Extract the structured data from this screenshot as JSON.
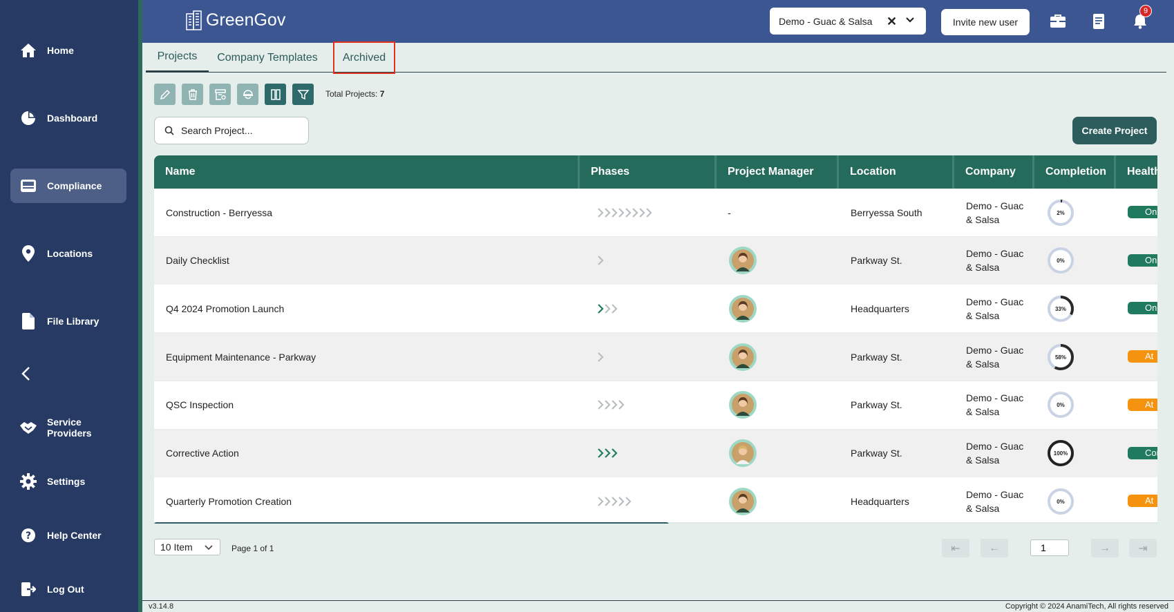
{
  "sidebar": {
    "items": [
      {
        "label": "Home",
        "icon": "home-icon"
      },
      {
        "label": "Dashboard",
        "icon": "pie-chart-icon"
      },
      {
        "label": "Compliance",
        "icon": "inbox-icon",
        "active": true
      },
      {
        "label": "Locations",
        "icon": "map-pin-icon"
      },
      {
        "label": "File Library",
        "icon": "file-icon"
      },
      {
        "label": "Service Providers",
        "icon": "handshake-icon"
      },
      {
        "label": "Settings",
        "icon": "gear-icon"
      },
      {
        "label": "Help Center",
        "icon": "help-icon"
      },
      {
        "label": "Log Out",
        "icon": "logout-icon"
      }
    ]
  },
  "header": {
    "logo_text": "GreenGov",
    "company_select": "Demo - Guac & Salsa",
    "invite_label": "Invite new user",
    "notification_count": "9"
  },
  "tabs": [
    {
      "label": "Projects",
      "active": true
    },
    {
      "label": "Company Templates"
    },
    {
      "label": "Archived",
      "highlighted": true
    }
  ],
  "toolbar": {
    "total_label": "Total Projects:",
    "total_value": "7",
    "buttons": [
      "edit-icon",
      "trash-icon",
      "archive-icon",
      "worker-icon",
      "columns-icon",
      "filter-icon"
    ]
  },
  "search": {
    "placeholder": "Search Project..."
  },
  "create_label": "Create Project",
  "table": {
    "columns": [
      "Name",
      "Phases",
      "Project Manager",
      "Location",
      "Company",
      "Completion",
      "Health"
    ],
    "rows": [
      {
        "name": "Construction - Berryessa",
        "phases_total": 8,
        "phases_done": 0,
        "manager": "-",
        "location": "Berryessa South",
        "company_line1": "Demo - Guac",
        "company_line2": "& Salsa",
        "completion": "2%",
        "completion_value": 0.02,
        "health": "On",
        "health_color": "#1f7a5e"
      },
      {
        "name": "Daily Checklist",
        "phases_total": 1,
        "phases_done": 0,
        "manager": "avatar-1",
        "location": "Parkway St.",
        "company_line1": "Demo - Guac",
        "company_line2": "& Salsa",
        "completion": "0%",
        "completion_value": 0,
        "health": "On",
        "health_color": "#1f7a5e"
      },
      {
        "name": "Q4 2024 Promotion Launch",
        "phases_total": 3,
        "phases_done": 1,
        "manager": "avatar-1",
        "location": "Headquarters",
        "company_line1": "Demo - Guac",
        "company_line2": "& Salsa",
        "completion": "33%",
        "completion_value": 0.33,
        "health": "On",
        "health_color": "#1f7a5e"
      },
      {
        "name": "Equipment Maintenance - Parkway",
        "phases_total": 1,
        "phases_done": 0,
        "manager": "avatar-1",
        "location": "Parkway St.",
        "company_line1": "Demo - Guac",
        "company_line2": "& Salsa",
        "completion": "58%",
        "completion_value": 0.58,
        "health": "At",
        "health_color": "#f5930f"
      },
      {
        "name": "QSC Inspection",
        "phases_total": 4,
        "phases_done": 0,
        "manager": "avatar-1",
        "location": "Parkway St.",
        "company_line1": "Demo - Guac",
        "company_line2": "& Salsa",
        "completion": "0%",
        "completion_value": 0,
        "health": "At",
        "health_color": "#f5930f"
      },
      {
        "name": "Corrective Action",
        "phases_total": 3,
        "phases_done": 3,
        "manager": "avatar-2",
        "location": "Parkway St.",
        "company_line1": "Demo - Guac",
        "company_line2": "& Salsa",
        "completion": "100%",
        "completion_value": 1.0,
        "health": "Cor",
        "health_color": "#1f7a5e"
      },
      {
        "name": "Quarterly Promotion Creation",
        "phases_total": 5,
        "phases_done": 0,
        "manager": "avatar-3",
        "location": "Headquarters",
        "company_line1": "Demo - Guac",
        "company_line2": "& Salsa",
        "completion": "0%",
        "completion_value": 0,
        "health": "At",
        "health_color": "#f5930f"
      }
    ]
  },
  "pagination": {
    "page_size": "10 Item",
    "page_info": "Page 1 of 1",
    "current_page": "1"
  },
  "footer": {
    "version": "v3.14.8",
    "copyright": "Copyright © 2024 AnamiTech, All rights reserved"
  }
}
